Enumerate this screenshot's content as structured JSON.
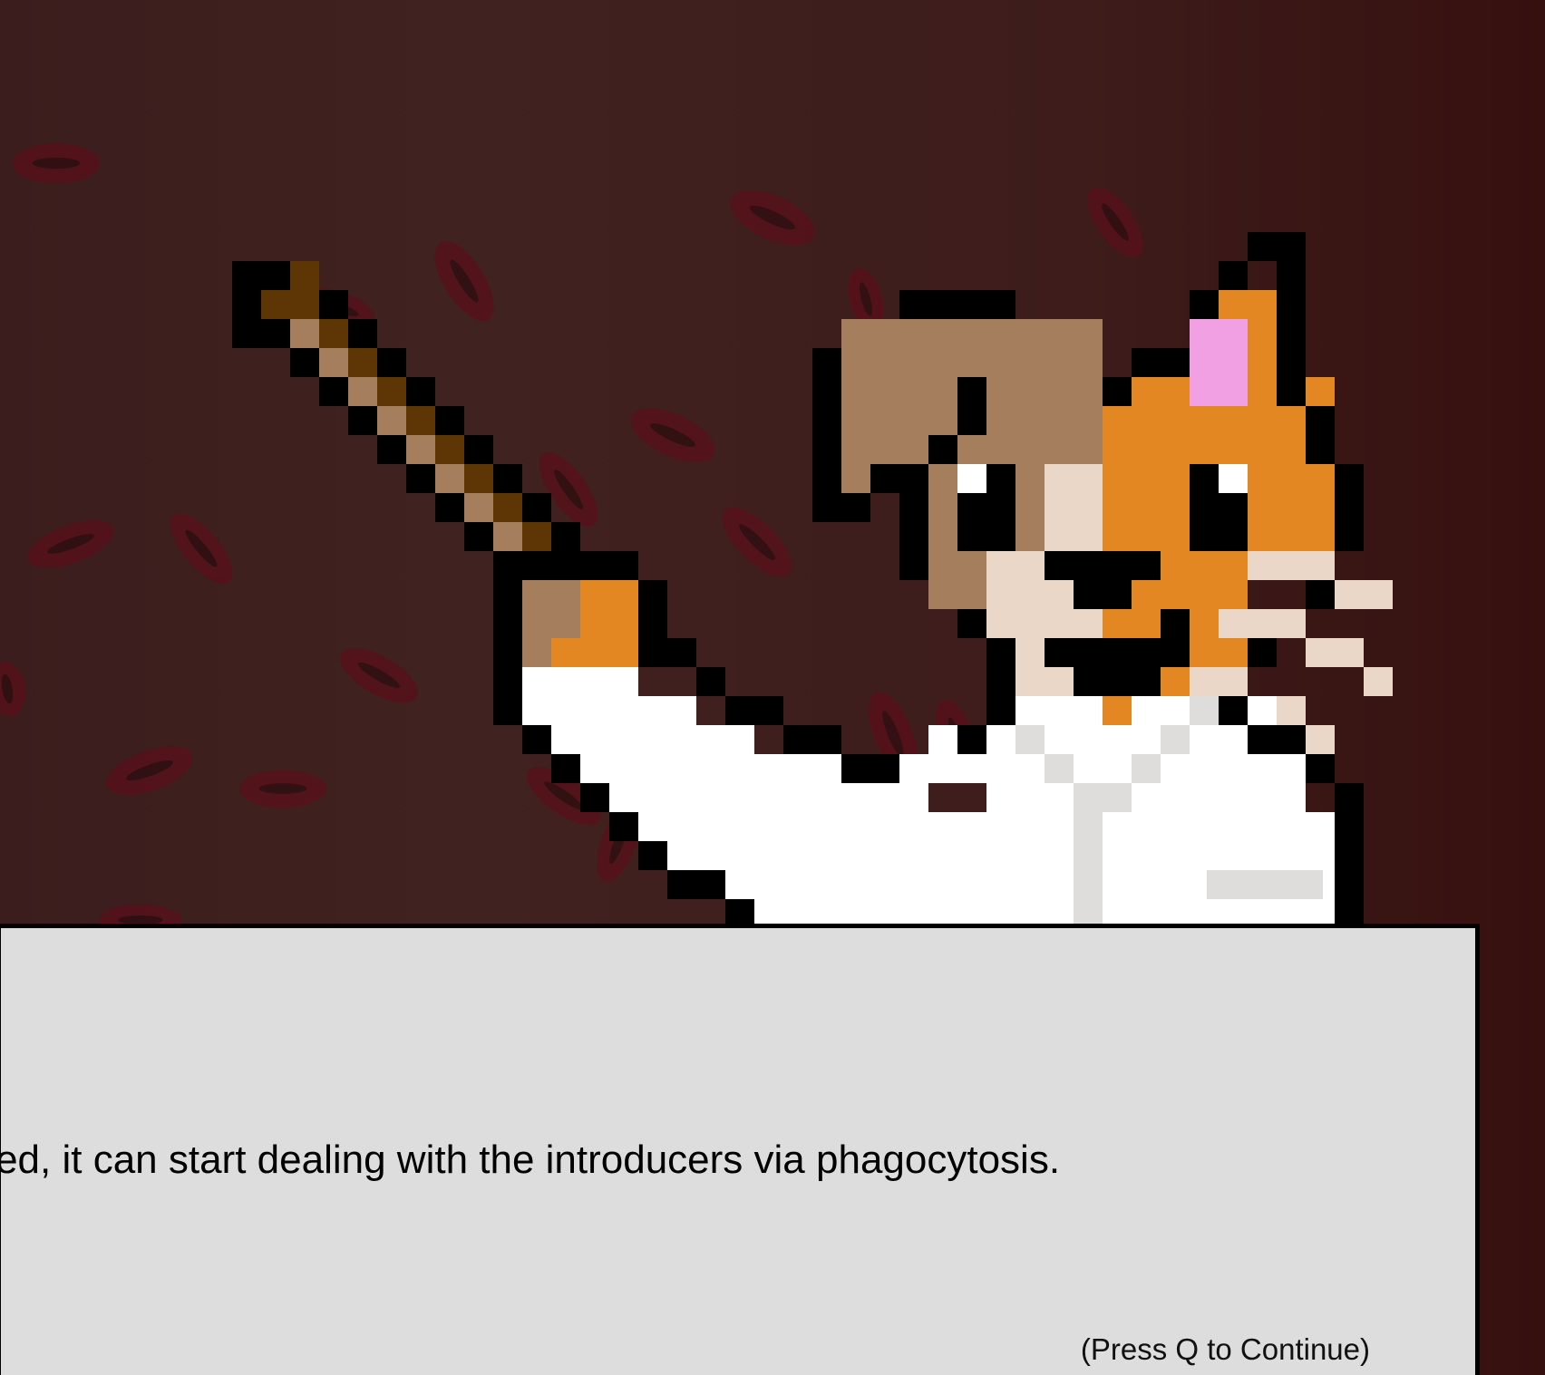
{
  "dialog": {
    "text": "rrived, it can start dealing with the introducers via phagocytosis.",
    "hint": "(Press Q to Continue)"
  },
  "colors": {
    "background_left": "#3b1d1d",
    "background_right": "#36100f",
    "blood_cell": "#5a0f1a",
    "dialog_panel": "#dddddd",
    "fur_orange": "#e38722",
    "fur_brown": "#a57f5d",
    "fur_cream": "#ebd7c7",
    "ear_pink": "#f2a0e4",
    "coat_white": "#ffffff",
    "coat_shadow": "#dedddb",
    "pointer_dark": "#5e3505"
  }
}
